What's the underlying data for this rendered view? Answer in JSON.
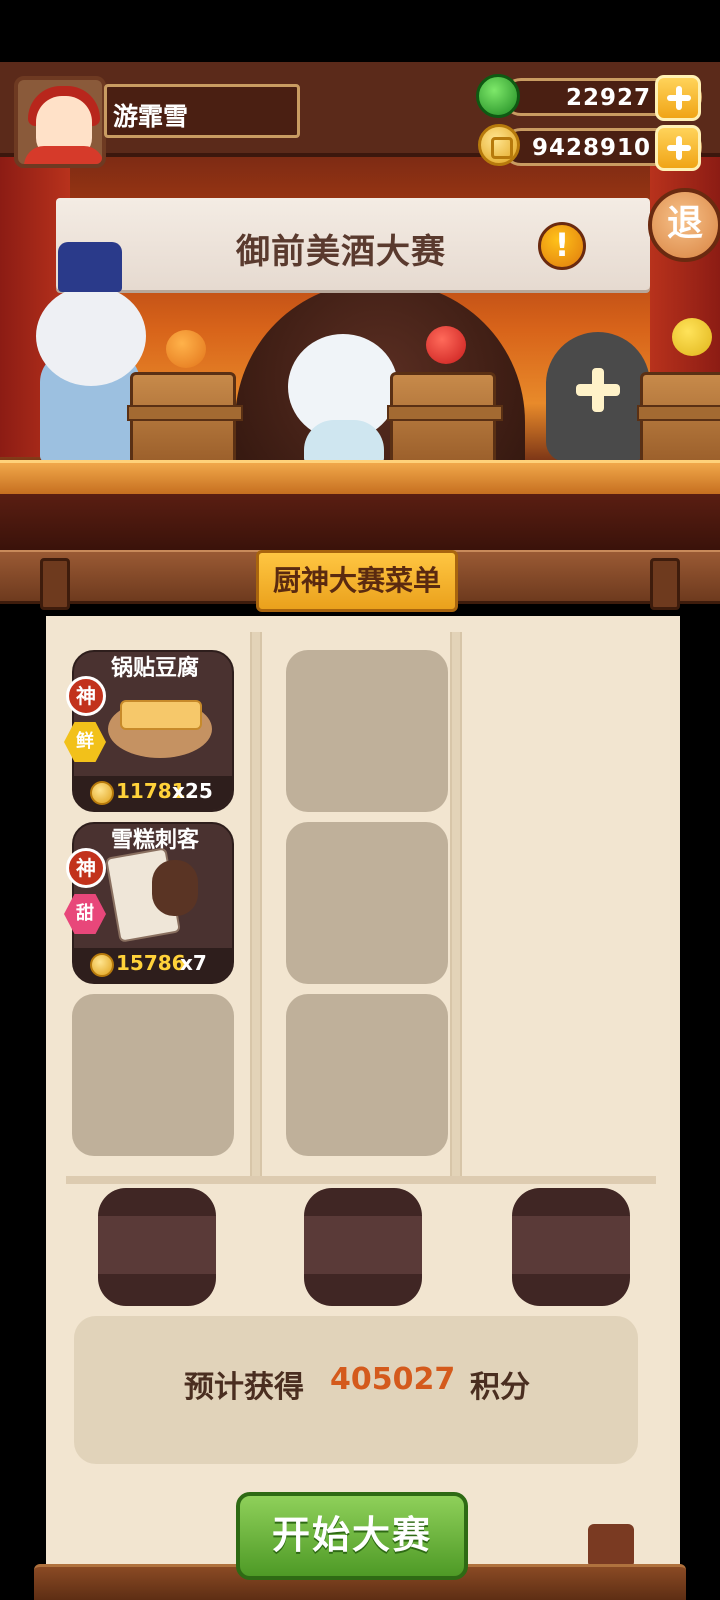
{
  "player": {
    "name": "游霏雪"
  },
  "resources": {
    "jade": "22927",
    "coins": "9428910"
  },
  "event": {
    "title": "御前美酒大赛",
    "alert": "!",
    "exit_label": "退"
  },
  "menu": {
    "title": "厨神大赛菜单",
    "dishes": [
      {
        "name": "锅贴豆腐",
        "grade": "神",
        "flavor": "鲜",
        "flavor_color": "#f2c11a",
        "price": "11781",
        "count": "x25"
      },
      {
        "name": "雪糕刺客",
        "grade": "神",
        "flavor": "甜",
        "flavor_color": "#e8477a",
        "price": "15786",
        "count": "x7"
      }
    ]
  },
  "score": {
    "prefix": "预计获得",
    "value": "405027",
    "suffix": "积分"
  },
  "start_button": "开始大赛"
}
